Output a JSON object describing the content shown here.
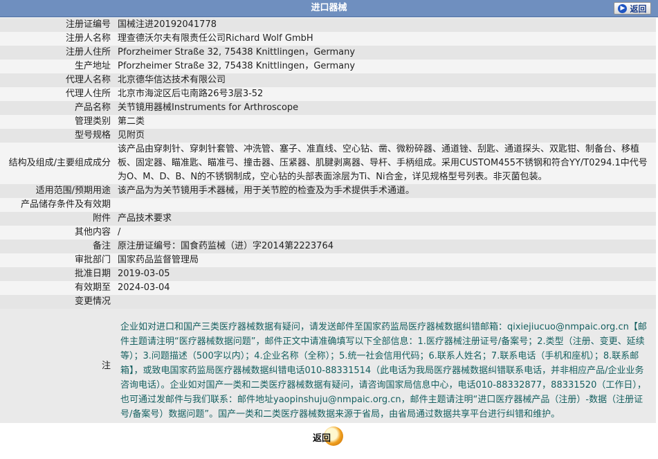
{
  "header": {
    "title": "进口器械",
    "back_label": "返回"
  },
  "rows": [
    {
      "label": "注册证编号",
      "value": "国械注进20192041778"
    },
    {
      "label": "注册人名称",
      "value": "理查德沃尔夫有限责任公司Richard Wolf GmbH"
    },
    {
      "label": "注册人住所",
      "value": "Pforzheimer Straße 32, 75438 Knittlingen，Germany"
    },
    {
      "label": "生产地址",
      "value": "Pforzheimer Straße 32, 75438 Knittlingen，Germany"
    },
    {
      "label": "代理人名称",
      "value": "北京德华信达技术有限公司"
    },
    {
      "label": "代理人住所",
      "value": "北京市海淀区后屯南路26号3层3-52"
    },
    {
      "label": "产品名称",
      "value": "关节镜用器械Instruments for Arthroscope"
    },
    {
      "label": "管理类别",
      "value": "第二类"
    },
    {
      "label": "型号规格",
      "value": "见附页"
    },
    {
      "label": "结构及组成/主要组成成分",
      "value": "该产品由穿刺针、穿刺针套管、冲洗管、塞子、准直线、空心钻、凿、微粉碎器、通道锉、刮匙、通道探头、双匙钳、制备台、移植板、固定器、瞄准匙、瞄准弓、撞击器、压紧器、肌腱剥离器、导杆、手柄组成。采用CUSTOM455不锈钢和符合YY/T0294.1中代号为O、M、D、B、N的不锈钢制成，空心钻的头部表面涂层为Ti、Ni合金，详见规格型号列表。非灭菌包装。"
    },
    {
      "label": "适用范围/预期用途",
      "value": "该产品为为关节镜用手术器械，用于关节腔的检查及为手术提供手术通道。"
    },
    {
      "label": "产品储存条件及有效期",
      "value": ""
    },
    {
      "label": "附件",
      "value": "产品技术要求"
    },
    {
      "label": "其他内容",
      "value": "/"
    },
    {
      "label": "备注",
      "value": "原注册证编号：国食药监械（进）字2014第2223764"
    },
    {
      "label": "审批部门",
      "value": "国家药品监督管理局"
    },
    {
      "label": "批准日期",
      "value": "2019-03-05"
    },
    {
      "label": "有效期至",
      "value": "2024-03-04"
    },
    {
      "label": "变更情况",
      "value": ""
    }
  ],
  "notice": {
    "label": "注",
    "text": "企业如对进口和国产三类医疗器械数据有疑问，请发送邮件至国家药监局医疗器械数据纠错邮箱：qixiejiucuo@nmpaic.org.cn【邮件主题请注明“医疗器械数据问题”，邮件正文中请准确填写以下全部信息：1.医疗器械注册证号/备案号；2.类型（注册、变更、延续等）；3.问题描述（500字以内）；4.企业名称（全称）；5.统一社会信用代码；6.联系人姓名；7.联系电话（手机和座机）；8.联系邮箱】，或致电国家药监局医疗器械数据纠错电话010-88331514（此电话为我局医疗器械数据纠错联系电话，并非相应产品/企业业务咨询电话）。企业如对国产一类和二类医疗器械数据有疑问，请咨询国家局信息中心，电话010-88332877，88331520（工作日），也可通过发邮件与我们联系：邮件地址yaopinshuju@nmpaic.org.cn，邮件主题请注明“进口医疗器械产品（注册）-数据（注册证号/备案号）数据问题”。国产一类和二类医疗器械数据来源于省局，由省局通过数据共享平台进行纠错和维护。"
  },
  "footer": {
    "back_label": "返回"
  }
}
